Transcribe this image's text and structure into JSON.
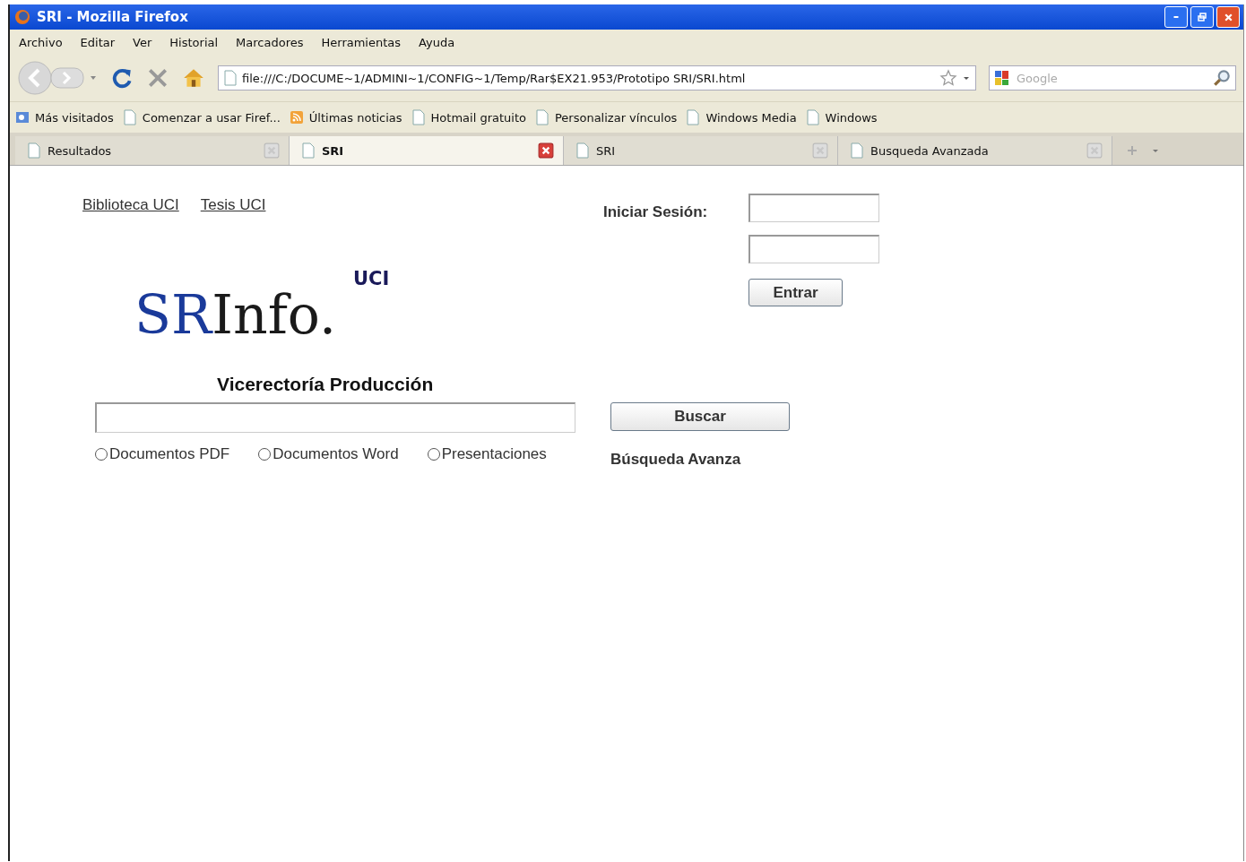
{
  "window": {
    "title": "SRI - Mozilla Firefox"
  },
  "menu": [
    "Archivo",
    "Editar",
    "Ver",
    "Historial",
    "Marcadores",
    "Herramientas",
    "Ayuda"
  ],
  "address_bar": {
    "value": "file:///C:/DOCUME~1/ADMINI~1/CONFIG~1/Temp/Rar$EX21.953/Prototipo SRI/SRI.html"
  },
  "search_box": {
    "placeholder": "Google"
  },
  "bookmarks": [
    {
      "label": "Más visitados",
      "kind": "special"
    },
    {
      "label": "Comenzar a usar Firef...",
      "kind": "page"
    },
    {
      "label": "Últimas noticias",
      "kind": "feed"
    },
    {
      "label": "Hotmail gratuito",
      "kind": "page"
    },
    {
      "label": "Personalizar vínculos",
      "kind": "page"
    },
    {
      "label": "Windows Media",
      "kind": "page"
    },
    {
      "label": "Windows",
      "kind": "page"
    }
  ],
  "tabs": [
    {
      "label": "Resultados",
      "selected": false
    },
    {
      "label": "SRI",
      "selected": true
    },
    {
      "label": "SRI",
      "selected": false
    },
    {
      "label": "Busqueda Avanzada",
      "selected": false
    }
  ],
  "page": {
    "links": [
      "Biblioteca UCI",
      "Tesis UCI"
    ],
    "logo": {
      "badge": "UCI",
      "parts": [
        {
          "text": "SR",
          "kind": "accent"
        },
        {
          "text": "Info.",
          "kind": "plain"
        }
      ]
    },
    "subtitle": "Vicerectoría Producción",
    "search_button": "Buscar",
    "options": [
      {
        "label": "Documentos PDF",
        "selected": false
      },
      {
        "label": "Documentos Word",
        "selected": false
      },
      {
        "label": "Presentaciones",
        "selected": false
      }
    ],
    "advanced_link": "Búsqueda Avanza",
    "login": {
      "label": "Iniciar Sesión:",
      "button": "Entrar"
    }
  }
}
